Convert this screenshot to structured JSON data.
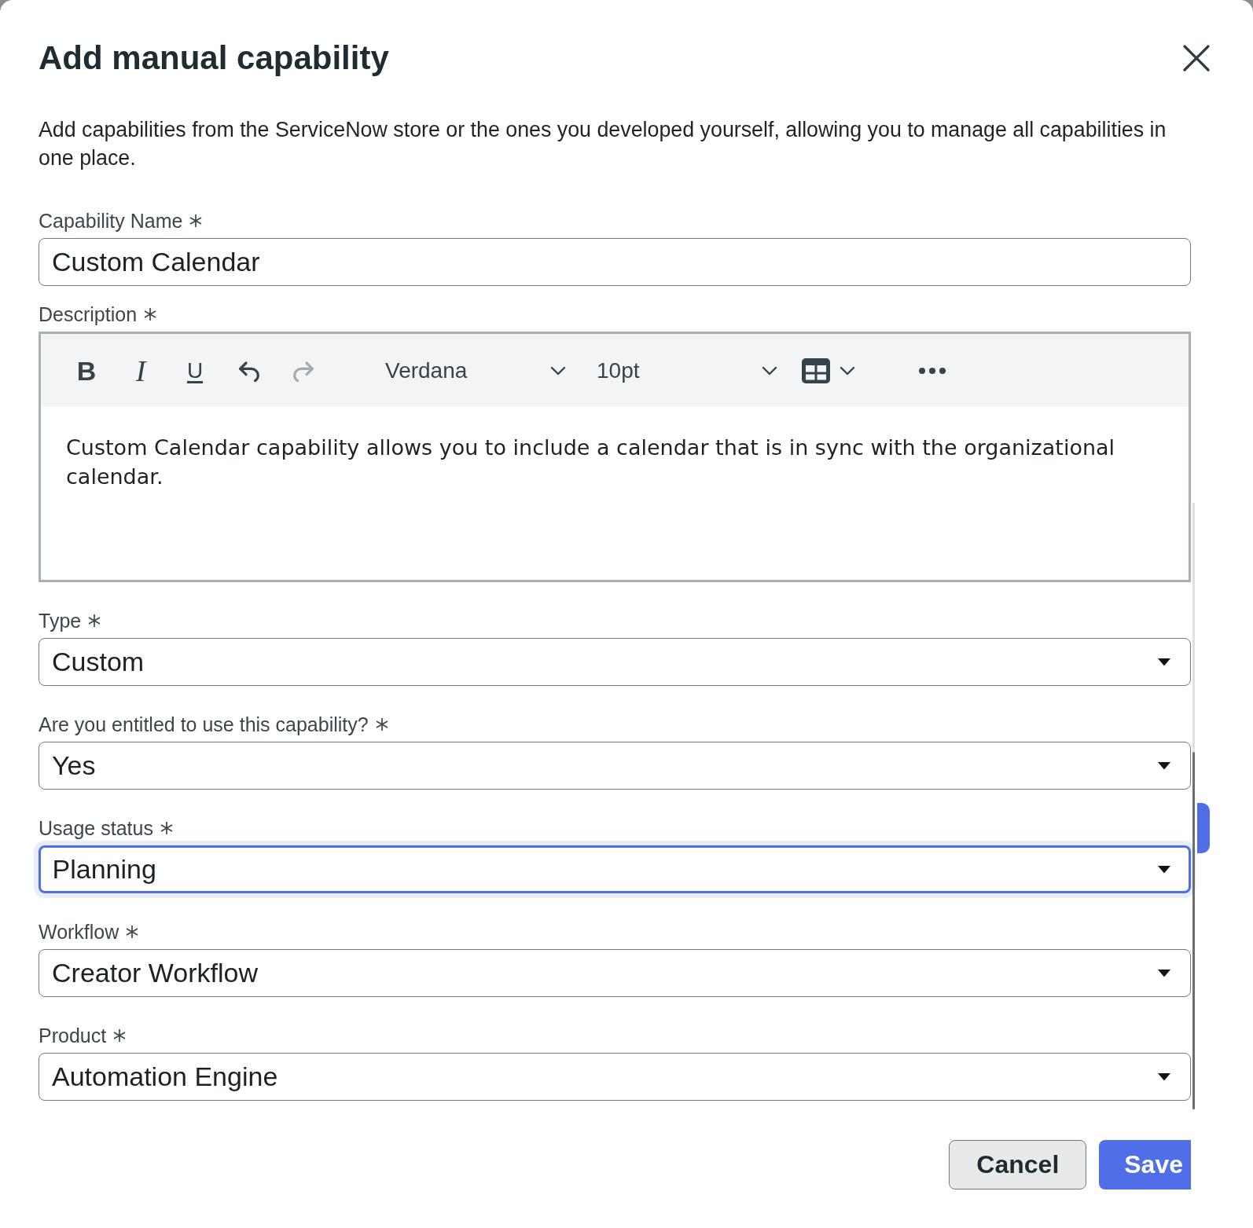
{
  "dialog": {
    "title": "Add manual capability",
    "intro": "Add capabilities from the ServiceNow store or the ones you developed yourself, allowing you to manage all capabilities in one place."
  },
  "fields": [
    {
      "kind": "text",
      "label": "Capability Name",
      "required": true,
      "value": "Custom Calendar",
      "focused": false
    },
    {
      "kind": "editor",
      "label": "Description",
      "required": true,
      "focused": false,
      "toolbar": [
        {
          "kind": "bold",
          "glyph": "B",
          "disabled": false
        },
        {
          "kind": "italic",
          "glyph": "I",
          "disabled": false
        },
        {
          "kind": "underline",
          "glyph": "U",
          "disabled": false
        },
        {
          "kind": "undo",
          "disabled": false
        },
        {
          "kind": "redo",
          "disabled": true
        },
        {
          "kind": "font",
          "value": "Verdana",
          "disabled": false
        },
        {
          "kind": "size",
          "value": "10pt",
          "disabled": false
        },
        {
          "kind": "table",
          "disabled": false
        },
        {
          "kind": "more",
          "disabled": false
        }
      ],
      "value": "Custom Calendar capability allows you to include a calendar that is in sync with the organizational calendar."
    },
    {
      "kind": "select",
      "label": "Type",
      "required": true,
      "value": "Custom",
      "focused": false
    },
    {
      "kind": "select",
      "label": "Are you entitled to use this capability?",
      "required": true,
      "value": "Yes",
      "focused": false
    },
    {
      "kind": "select",
      "label": "Usage status",
      "required": true,
      "value": "Planning",
      "focused": true
    },
    {
      "kind": "select",
      "label": "Workflow",
      "required": true,
      "value": "Creator Workflow",
      "focused": false
    },
    {
      "kind": "select",
      "label": "Product",
      "required": true,
      "value": "Automation Engine",
      "focused": false
    }
  ],
  "buttons": [
    {
      "kind": "secondary",
      "label": "Cancel"
    },
    {
      "kind": "primary",
      "label": "Save"
    }
  ]
}
